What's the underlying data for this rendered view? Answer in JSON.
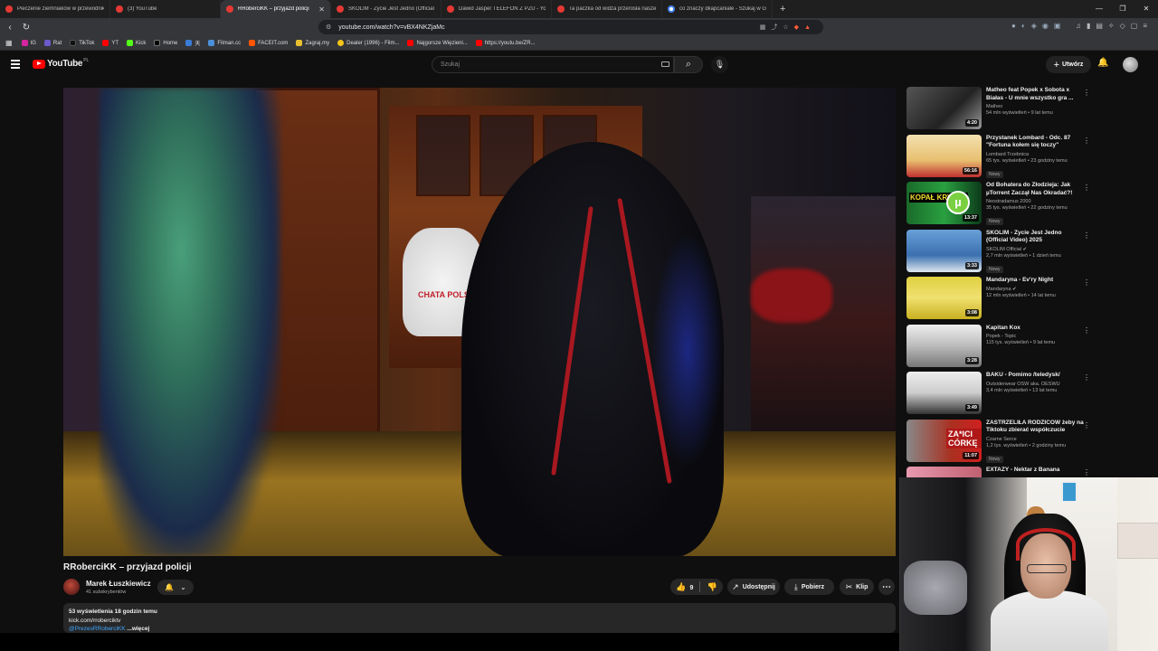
{
  "browser": {
    "tabs": [
      {
        "title": "Pieczenie ziemniaków w przewodnika",
        "active": false,
        "favicon": "youtube-favicon"
      },
      {
        "title": "(3) YouTube",
        "active": false,
        "favicon": "youtube-favicon"
      },
      {
        "title": "RRoberciKK – przyjazd policji",
        "active": true,
        "favicon": "youtube-favicon"
      },
      {
        "title": "SKOLIM - Życie Jest Jedno (Official V",
        "active": false,
        "favicon": "youtube-favicon"
      },
      {
        "title": "Dawid Jasper TELEFON Z PZU - YouT",
        "active": false,
        "favicon": "youtube-favicon"
      },
      {
        "title": "Ta paczka od widza przerosła nasze",
        "active": false,
        "favicon": "youtube-favicon"
      },
      {
        "title": "co znaczy dkapcaniale - Szukaj w Go",
        "active": false,
        "favicon": "google-favicon"
      }
    ],
    "new_tab": "+",
    "url": "youtube.com/watch?v=vBX4NKZjaMc",
    "bookmarks": [
      {
        "label": "IG",
        "color": "#d6249f"
      },
      {
        "label": "Rat",
        "color": "#6a5acd"
      },
      {
        "label": "TikTok",
        "color": "#111111"
      },
      {
        "label": "YT",
        "color": "#ff0000"
      },
      {
        "label": "Kick",
        "color": "#53fc18"
      },
      {
        "label": "Home",
        "color": "#000000"
      },
      {
        "label": "天",
        "color": "#3a7bd5"
      },
      {
        "label": "Filman.cc",
        "color": "#4a90d9"
      },
      {
        "label": "FACEIT.com",
        "color": "#ff5500"
      },
      {
        "label": "Zagraj.my",
        "color": "#e8c030"
      },
      {
        "label": "Dealer (1996) - Film...",
        "color": "#f5c518"
      },
      {
        "label": "Najgorsze Więzieni...",
        "color": "#ff0000"
      },
      {
        "label": "https://youtu.be/ZR...",
        "color": "#ff0000"
      }
    ]
  },
  "youtube": {
    "logo_text": "YouTube",
    "country": "PL",
    "search_placeholder": "Szukaj",
    "create_label": "Utwórz"
  },
  "video": {
    "title": "RRoberciKK – przyjazd policji",
    "bag_text": "CHATA POLSKA",
    "channel_name": "Marek Łuszkiewicz",
    "subscribers": "41 subskrybentów",
    "likes": "9",
    "share_label": "Udostępnij",
    "download_label": "Pobierz",
    "clip_label": "Klip",
    "stats": "53 wyświetlenia  18 godzin temu",
    "desc_line1": "kick.com/rroberciktv",
    "desc_link": "@PrezesRRoberciKK",
    "desc_more": " ...więcej"
  },
  "recommendations": [
    {
      "title": "Matheo feat Popek x Sobota x Białas - U mnie wszystko gra ...",
      "channel": "Matheo",
      "meta": "54 mln wyświetleń • 9 lat temu",
      "duration": "4:20",
      "badge": ""
    },
    {
      "title": "Przystanek Lombard - Odc. 87 \"Fortuna kołem się toczy\"",
      "channel": "Lombard Trzebnica",
      "meta": "65 tys. wyświetleń • 23 godziny temu",
      "duration": "56:16",
      "badge": "Nowy"
    },
    {
      "title": "Od Bohatera do Złodzieja: Jak µTorrent Zaczął Nas Okradać?!",
      "channel": "Neostradamus 2000",
      "meta": "35 tys. wyświetleń • 22 godziny temu",
      "duration": "13:37",
      "badge": "Nowy",
      "thumb_text": "KOPAŁ KRYPTO"
    },
    {
      "title": "SKOLIM - Życie Jest Jedno (Official Video) 2025",
      "channel": "SKOLIM Official ✔",
      "meta": "2,7 mln wyświetleń • 1 dzień temu",
      "duration": "3:33",
      "badge": "Nowy"
    },
    {
      "title": "Mandaryna - Ev'ry Night",
      "channel": "Mandaryna ✔",
      "meta": "12 mln wyświetleń • 14 lat temu",
      "duration": "3:08",
      "badge": ""
    },
    {
      "title": "Kapitan Kox",
      "channel": "Popek - Topic",
      "meta": "115 tys. wyświetleń • 9 lat temu",
      "duration": "3:28",
      "badge": ""
    },
    {
      "title": "BAKU - Pomimo /teledysk/",
      "channel": "Outsiderwear OSW aka. OESWU",
      "meta": "3,4 mln wyświetleń • 13 lat temu",
      "duration": "3:49",
      "badge": ""
    },
    {
      "title": "ZASTRZELIŁA RODZICÓW żeby na Tiktoku zbierać współczucie",
      "channel": "Czarne Serce",
      "meta": "1,2 tys. wyświetleń • 2 godziny temu",
      "duration": "11:07",
      "badge": "Nowy",
      "thumb_text": "ZA*ICI CÓRKĘ"
    },
    {
      "title": "EXTAZY - Nektar z Banana",
      "channel": "",
      "meta": "",
      "duration": "",
      "badge": ""
    }
  ]
}
